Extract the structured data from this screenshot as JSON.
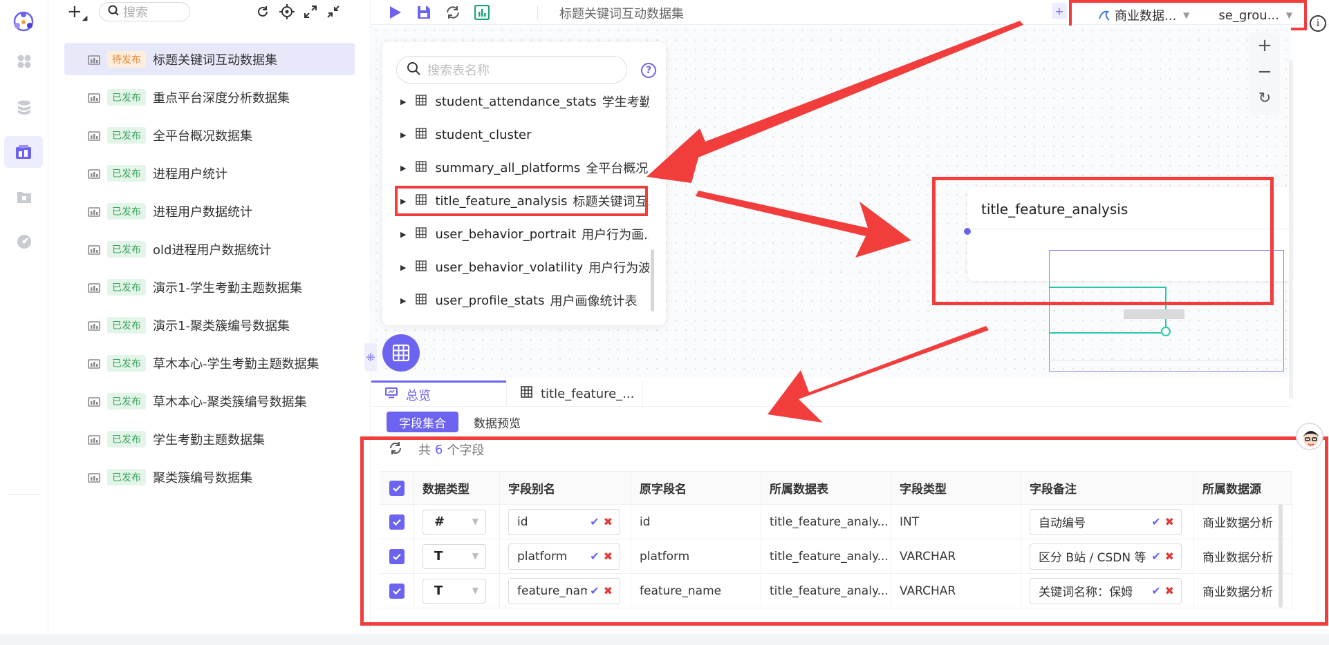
{
  "colors": {
    "accent": "#6c63f0",
    "annotation_red": "#f23d3d",
    "published_green": "#3aa45c",
    "pending_orange": "#e6883a",
    "minimap_teal": "#2cc7a8"
  },
  "rail": {
    "icons": [
      "logo-icon",
      "apps-icon",
      "database-icon",
      "dataset-icon",
      "folder-icon",
      "dashboard-icon"
    ],
    "active": "dataset-icon"
  },
  "list_panel": {
    "add_label": "+",
    "search_placeholder": "搜索",
    "tools": [
      "refresh-icon",
      "locate-icon",
      "expand-icon",
      "collapse-icon"
    ],
    "datasets": [
      {
        "status": "待发布",
        "status_type": "pending",
        "name": "标题关键词互动数据集",
        "selected": true
      },
      {
        "status": "已发布",
        "status_type": "published",
        "name": "重点平台深度分析数据集"
      },
      {
        "status": "已发布",
        "status_type": "published",
        "name": "全平台概况数据集"
      },
      {
        "status": "已发布",
        "status_type": "published",
        "name": "进程用户统计"
      },
      {
        "status": "已发布",
        "status_type": "published",
        "name": "进程用户数据统计"
      },
      {
        "status": "已发布",
        "status_type": "published",
        "name": "old进程用户数据统计"
      },
      {
        "status": "已发布",
        "status_type": "published",
        "name": "演示1-学生考勤主题数据集"
      },
      {
        "status": "已发布",
        "status_type": "published",
        "name": "演示1-聚类簇编号数据集"
      },
      {
        "status": "已发布",
        "status_type": "published",
        "name": "草木本心-学生考勤主题数据集"
      },
      {
        "status": "已发布",
        "status_type": "published",
        "name": "草木本心-聚类簇编号数据集"
      },
      {
        "status": "已发布",
        "status_type": "published",
        "name": "学生考勤主题数据集"
      },
      {
        "status": "已发布",
        "status_type": "published",
        "name": "聚类簇编号数据集"
      }
    ]
  },
  "top_bar": {
    "title": "标题关键词互动数据集",
    "datasource_label": "商业数据...",
    "schema_label": "se_grou...",
    "add_label": "+"
  },
  "picker": {
    "search_placeholder": "搜索表名称",
    "help_label": "?",
    "tables": [
      {
        "name": "student_attendance_stats",
        "cn": "学生考勤..."
      },
      {
        "name": "student_cluster",
        "cn": ""
      },
      {
        "name": "summary_all_platforms",
        "cn": "全平台概况..."
      },
      {
        "name": "title_feature_analysis",
        "cn": "标题关键词互...",
        "highlighted": true
      },
      {
        "name": "user_behavior_portrait",
        "cn": "用户行为画..."
      },
      {
        "name": "user_behavior_volatility",
        "cn": "用户行为波..."
      },
      {
        "name": "user_profile_stats",
        "cn": "用户画像统计表"
      }
    ]
  },
  "canvas": {
    "node_title": "title_feature_analysis",
    "zoom_in": "+",
    "zoom_out": "−",
    "zoom_reset": "↻"
  },
  "bottom": {
    "tab_overview": "总览",
    "tab_table": "title_feature_...",
    "subtab_fields": "字段集合",
    "subtab_preview": "数据预览",
    "summary_prefix": "共",
    "field_count": "6",
    "summary_suffix": "个字段",
    "columns": [
      "数据类型",
      "字段别名",
      "原字段名",
      "所属数据表",
      "字段类型",
      "字段备注",
      "所属数据源"
    ],
    "rows": [
      {
        "type": "#",
        "alias": "id",
        "orig": "id",
        "table": "title_feature_analy...",
        "ftype": "INT",
        "remark": "自动编号",
        "source": "商业数据分析"
      },
      {
        "type": "T",
        "alias": "platform",
        "orig": "platform",
        "table": "title_feature_analy...",
        "ftype": "VARCHAR",
        "remark": "区分 B站 / CSDN 等",
        "source": "商业数据分析"
      },
      {
        "type": "T",
        "alias": "feature_name",
        "orig": "feature_name",
        "table": "title_feature_analy...",
        "ftype": "VARCHAR",
        "remark": "关键词名称：保姆",
        "source": "商业数据分析"
      }
    ]
  }
}
